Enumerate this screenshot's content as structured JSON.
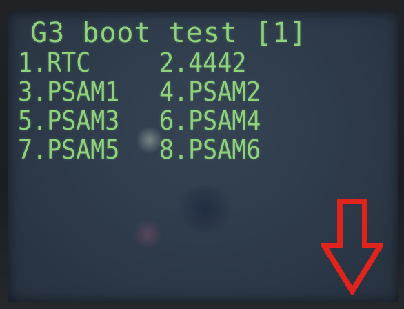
{
  "screen": {
    "title": "G3 boot test [1]",
    "menu_items": [
      "1.RTC",
      "2.4442",
      "3.PSAM1",
      "4.PSAM2",
      "5.PSAM3",
      "6.PSAM4",
      "7.PSAM5",
      "8.PSAM6"
    ]
  },
  "annotation": {
    "icon": "down-arrow-icon",
    "color": "#e0241c"
  },
  "colors": {
    "screen_background": "#2f3c4b",
    "text": "#8ed27c"
  }
}
